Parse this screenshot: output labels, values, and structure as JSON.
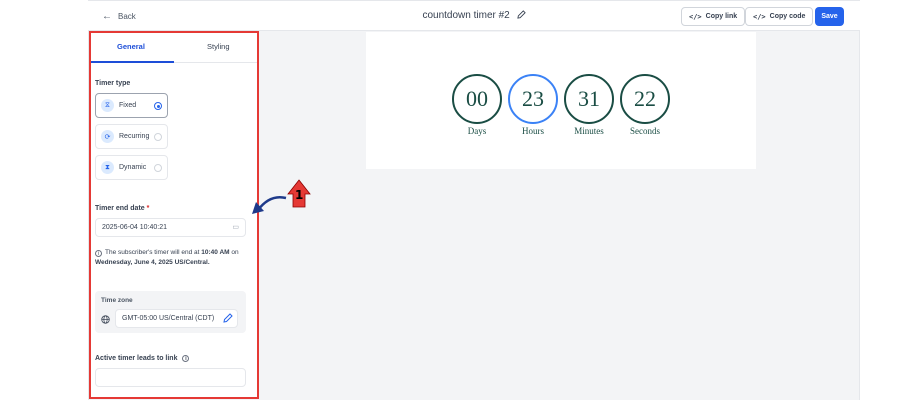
{
  "topbar": {
    "back_label": "Back",
    "title": "countdown timer #2",
    "copy_link_label": "Copy link",
    "copy_code_label": "Copy code",
    "save_label": "Save"
  },
  "tabs": [
    {
      "label": "General",
      "active": true
    },
    {
      "label": "Styling",
      "active": false
    }
  ],
  "timer_type": {
    "label": "Timer type",
    "options": [
      {
        "label": "Fixed",
        "selected": true,
        "icon": "hourglass-icon"
      },
      {
        "label": "Recurring",
        "selected": false,
        "icon": "recurring-icon"
      },
      {
        "label": "Dynamic",
        "selected": false,
        "icon": "dynamic-icon"
      }
    ]
  },
  "end_date": {
    "label": "Timer end date",
    "required_mark": "*",
    "value": "2025-06-04 10:40:21"
  },
  "info": {
    "text_before": "The subscriber's timer will end at ",
    "time": "10:40 AM",
    "text_mid": " on ",
    "date": "Wednesday, June 4, 2025 US/Central."
  },
  "timezone": {
    "label": "Time zone",
    "value": "GMT-05:00 US/Central (CDT)"
  },
  "active_link": {
    "label": "Active timer leads to link",
    "value": ""
  },
  "countdown": {
    "units": [
      {
        "value": "00",
        "label": "Days"
      },
      {
        "value": "23",
        "label": "Hours"
      },
      {
        "value": "31",
        "label": "Minutes"
      },
      {
        "value": "22",
        "label": "Seconds"
      }
    ]
  },
  "annotation": {
    "number": "1"
  },
  "colors": {
    "accent": "#2563eb",
    "highlight": "#e53935",
    "timer": "#1a4d44",
    "timer_alt": "#3b82f6"
  }
}
